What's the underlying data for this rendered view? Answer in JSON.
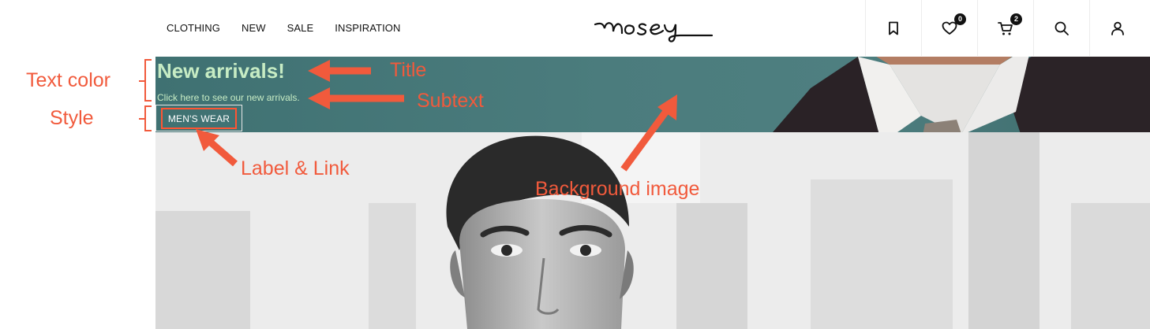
{
  "nav": {
    "items": [
      "CLOTHING",
      "NEW",
      "SALE",
      "INSPIRATION"
    ]
  },
  "logo": {
    "text": "mosey"
  },
  "header_icons": [
    {
      "name": "bookmark-icon"
    },
    {
      "name": "heart-icon",
      "badge": "0"
    },
    {
      "name": "cart-icon",
      "badge": "2"
    },
    {
      "name": "search-icon"
    },
    {
      "name": "user-icon"
    }
  ],
  "banner": {
    "title": "New arrivals!",
    "subtext": "Click here to see our new arrivals.",
    "label": "MEN'S WEAR",
    "text_color": "#c7ecc4",
    "background_color": "#4b7c7d"
  },
  "annotations": {
    "text_color": "Text color",
    "style": "Style",
    "title": "Title",
    "subtext": "Subtext",
    "label_link": "Label & Link",
    "background_image": "Background image",
    "color": "#f15a3c"
  }
}
